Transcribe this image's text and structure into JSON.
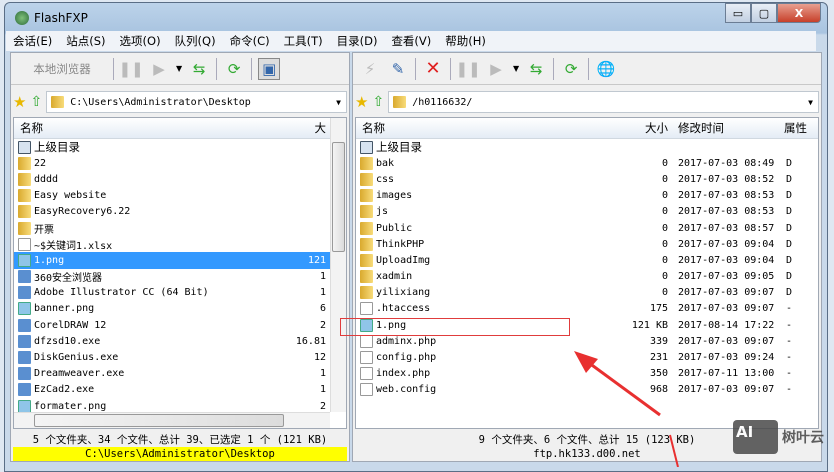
{
  "window": {
    "title": "FlashFXP",
    "minimize": "▭",
    "maximize": "▢",
    "close": "X"
  },
  "menu": [
    "会话(E)",
    "站点(S)",
    "选项(O)",
    "队列(Q)",
    "命令(C)",
    "工具(T)",
    "目录(D)",
    "查看(V)",
    "帮助(H)"
  ],
  "left": {
    "browser_label": "本地浏览器",
    "path": "C:\\Users\\Administrator\\Desktop",
    "columns": {
      "name": "名称",
      "size": "大"
    },
    "rows": [
      {
        "name": "上级目录",
        "size": "",
        "type": "up"
      },
      {
        "name": "22",
        "size": "",
        "type": "folder"
      },
      {
        "name": "dddd",
        "size": "",
        "type": "folder"
      },
      {
        "name": "Easy website",
        "size": "",
        "type": "folder"
      },
      {
        "name": "EasyRecovery6.22",
        "size": "",
        "type": "folder"
      },
      {
        "name": "开票",
        "size": "",
        "type": "folder"
      },
      {
        "name": "~$关键词1.xlsx",
        "size": "",
        "type": "file"
      },
      {
        "name": "1.png",
        "size": "121",
        "type": "png",
        "selected": true
      },
      {
        "name": "360安全浏览器",
        "size": "1",
        "type": "exe"
      },
      {
        "name": "Adobe Illustrator CC (64 Bit)",
        "size": "1",
        "type": "exe"
      },
      {
        "name": "banner.png",
        "size": "6",
        "type": "png"
      },
      {
        "name": "CorelDRAW 12",
        "size": "2",
        "type": "exe"
      },
      {
        "name": "dfzsd10.exe",
        "size": "16.81",
        "type": "exe"
      },
      {
        "name": "DiskGenius.exe",
        "size": "12",
        "type": "exe"
      },
      {
        "name": "Dreamweaver.exe",
        "size": "1",
        "type": "exe"
      },
      {
        "name": "EzCad2.exe",
        "size": "1",
        "type": "exe"
      },
      {
        "name": "formater.png",
        "size": "2",
        "type": "png"
      }
    ],
    "status": "5 个文件夹、34 个文件、总计 39、已选定 1 个 (121 KB)",
    "status_path": "C:\\Users\\Administrator\\Desktop"
  },
  "right": {
    "path": "/h0116632/",
    "columns": {
      "name": "名称",
      "size": "大小",
      "date": "修改时间",
      "attr": "属性"
    },
    "rows": [
      {
        "name": "上级目录",
        "size": "",
        "date": "",
        "attr": "",
        "type": "up"
      },
      {
        "name": "bak",
        "size": "0",
        "date": "2017-07-03 08:49",
        "attr": "D",
        "type": "folder"
      },
      {
        "name": "css",
        "size": "0",
        "date": "2017-07-03 08:52",
        "attr": "D",
        "type": "folder"
      },
      {
        "name": "images",
        "size": "0",
        "date": "2017-07-03 08:53",
        "attr": "D",
        "type": "folder"
      },
      {
        "name": "js",
        "size": "0",
        "date": "2017-07-03 08:53",
        "attr": "D",
        "type": "folder"
      },
      {
        "name": "Public",
        "size": "0",
        "date": "2017-07-03 08:57",
        "attr": "D",
        "type": "folder"
      },
      {
        "name": "ThinkPHP",
        "size": "0",
        "date": "2017-07-03 09:04",
        "attr": "D",
        "type": "folder"
      },
      {
        "name": "UploadImg",
        "size": "0",
        "date": "2017-07-03 09:04",
        "attr": "D",
        "type": "folder"
      },
      {
        "name": "xadmin",
        "size": "0",
        "date": "2017-07-03 09:05",
        "attr": "D",
        "type": "folder"
      },
      {
        "name": "yilixiang",
        "size": "0",
        "date": "2017-07-03 09:07",
        "attr": "D",
        "type": "folder"
      },
      {
        "name": ".htaccess",
        "size": "175",
        "date": "2017-07-03 09:07",
        "attr": "-",
        "type": "file"
      },
      {
        "name": "1.png",
        "size": "121 KB",
        "date": "2017-08-14 17:22",
        "attr": "-",
        "type": "png"
      },
      {
        "name": "adminx.php",
        "size": "339",
        "date": "2017-07-03 09:07",
        "attr": "-",
        "type": "file"
      },
      {
        "name": "config.php",
        "size": "231",
        "date": "2017-07-03 09:24",
        "attr": "-",
        "type": "file"
      },
      {
        "name": "index.php",
        "size": "350",
        "date": "2017-07-11 13:00",
        "attr": "-",
        "type": "file"
      },
      {
        "name": "web.config",
        "size": "968",
        "date": "2017-07-03 09:07",
        "attr": "-",
        "type": "file"
      }
    ],
    "status": "9 个文件夹、6 个文件、总计 15 (123 KB)",
    "status_host": "ftp.hk133.d00.net"
  },
  "watermark": {
    "logo": "AI",
    "text": "树叶云"
  }
}
